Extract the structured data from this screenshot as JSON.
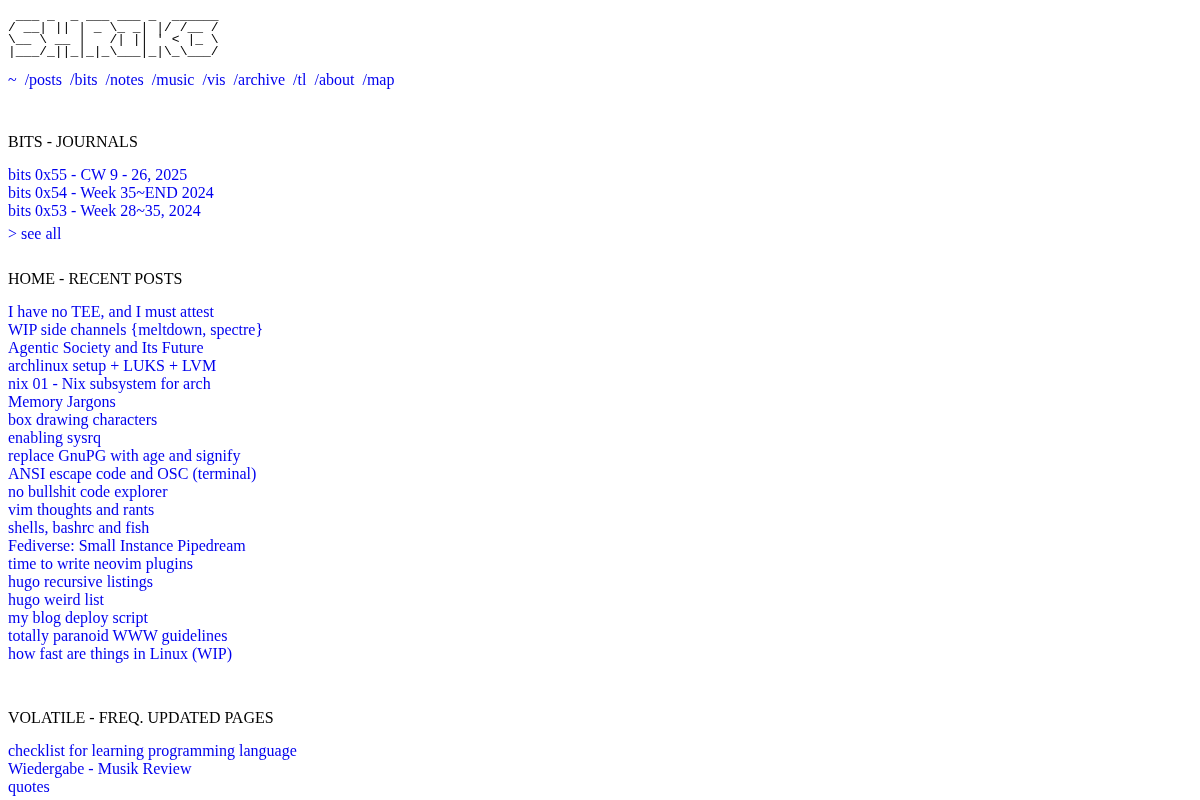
{
  "logo": {
    "lines": [
      " ___ _  _ ___ ___ _  ______",
      "/ __| || | _ \\_ _| |/ /__ /",
      "\\__ \\ __ |   /| || ' < |_ \\",
      "|___/_||_|_|_\\___|_|\\_\\___/"
    ]
  },
  "nav": [
    {
      "label": "~"
    },
    {
      "label": "/posts"
    },
    {
      "label": "/bits"
    },
    {
      "label": "/notes"
    },
    {
      "label": "/music"
    },
    {
      "label": "/vis"
    },
    {
      "label": "/archive"
    },
    {
      "label": "/tl"
    },
    {
      "label": "/about"
    },
    {
      "label": "/map"
    }
  ],
  "sections": [
    {
      "title": "BITS - JOURNALS",
      "links": [
        "bits 0x55 - CW 9 - 26, 2025",
        "bits 0x54 - Week 35~END 2024",
        "bits 0x53 - Week 28~35, 2024"
      ],
      "more": "> see all"
    },
    {
      "title": "HOME - RECENT POSTS",
      "links": [
        "I have no TEE, and I must attest",
        "WIP side channels {meltdown, spectre}",
        "Agentic Society and Its Future",
        "archlinux setup + LUKS + LVM",
        "nix 01 - Nix subsystem for arch",
        "Memory Jargons",
        "box drawing characters",
        "enabling sysrq",
        "replace GnuPG with age and signify",
        "ANSI escape code and OSC (terminal)",
        "no bullshit code explorer",
        "vim thoughts and rants",
        "shells, bashrc and fish",
        "Fediverse: Small Instance Pipedream",
        "time to write neovim plugins",
        "hugo recursive listings",
        "hugo weird list",
        "my blog deploy script",
        "totally paranoid WWW guidelines",
        "how fast are things in Linux (WIP)"
      ]
    },
    {
      "title": "VOLATILE - FREQ. UPDATED PAGES",
      "links": [
        "checklist for learning programming language",
        "Wiedergabe - Musik Review",
        "quotes"
      ]
    }
  ]
}
